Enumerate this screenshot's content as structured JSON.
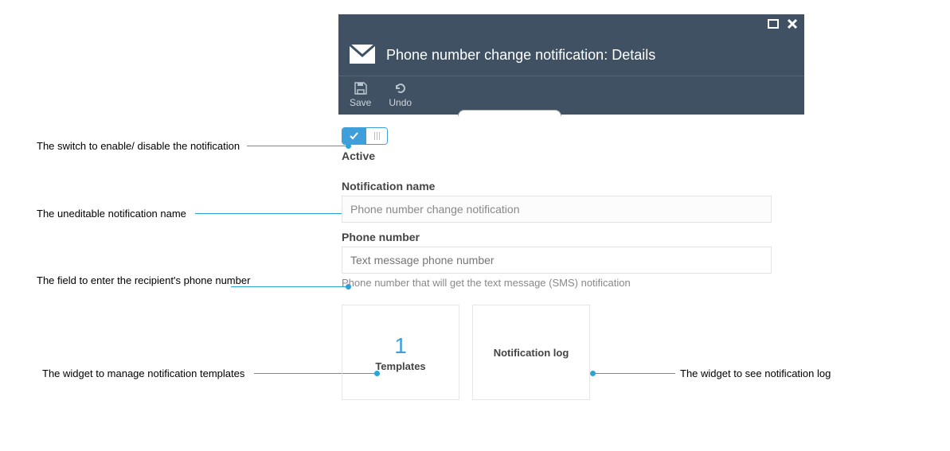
{
  "callouts": {
    "toggle": "The switch to enable/ disable the notification",
    "name": "The uneditable notification name",
    "phone": "The field to enter the recipient's phone number",
    "templates": "The widget to manage notification templates",
    "log": "The widget to see notification log"
  },
  "header": {
    "title": "Phone number change notification: Details"
  },
  "toolbar": {
    "save": "Save",
    "undo": "Undo"
  },
  "form": {
    "active_label": "Active",
    "name_label": "Notification name",
    "name_value": "Phone number change notification",
    "phone_label": "Phone number",
    "phone_placeholder": "Text message phone number",
    "phone_help": "Phone number that will get the text message (SMS) notification"
  },
  "tiles": {
    "templates_count": "1",
    "templates_label": "Templates",
    "log_label": "Notification log"
  }
}
